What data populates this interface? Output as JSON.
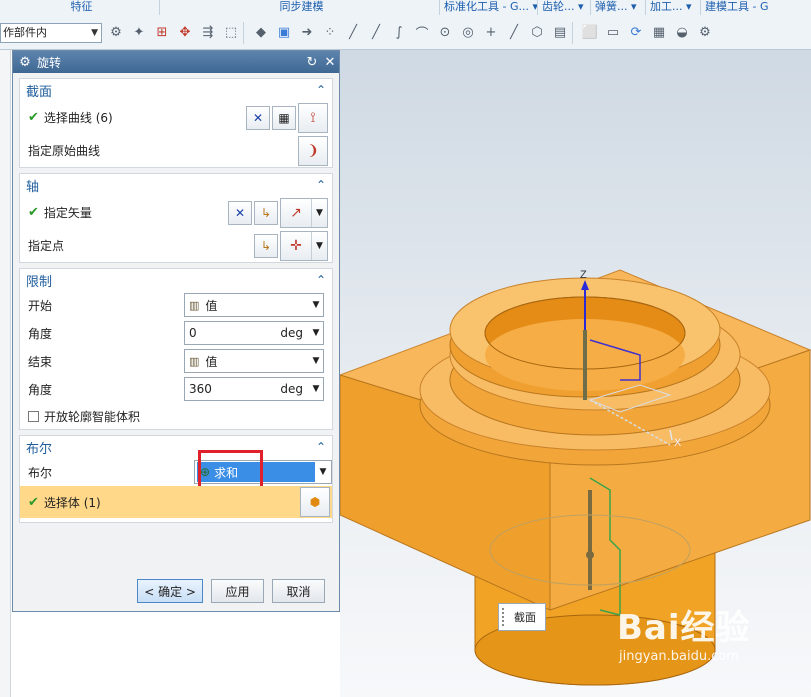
{
  "ribbon": {
    "groups": [
      "特征",
      "同步建模",
      "标准化工具 - G...",
      "齿轮...",
      "弹簧...",
      "加工...",
      "建模工具 - G"
    ],
    "scope_select": "作部件内"
  },
  "dialog": {
    "title": "旋转",
    "section": {
      "header": "截面",
      "select_curve": "选择曲线 (6)",
      "origin_curve": "指定原始曲线"
    },
    "axis": {
      "header": "轴",
      "vector": "指定矢量",
      "point": "指定点"
    },
    "limits": {
      "header": "限制",
      "start_label": "开始",
      "start_value": "值",
      "angle1_label": "角度",
      "angle1_value": "0",
      "angle1_unit": "deg",
      "end_label": "结束",
      "end_value": "值",
      "angle2_label": "角度",
      "angle2_value": "360",
      "angle2_unit": "deg",
      "open_profile": "开放轮廓智能体积"
    },
    "boolean": {
      "header": "布尔",
      "label": "布尔",
      "value": "求和",
      "select_body": "选择体 (1)"
    },
    "buttons": {
      "ok": "< 确定 >",
      "apply": "应用",
      "cancel": "取消"
    }
  },
  "viewport": {
    "z_label": "Z",
    "x_label": "X",
    "section_tag": "截面",
    "model_color": "#f6b04a",
    "accent": "#3a8ee6",
    "highlight": "#e0202a"
  },
  "watermark": {
    "brand": "Bai经验",
    "url": "jingyan.baidu.com"
  }
}
